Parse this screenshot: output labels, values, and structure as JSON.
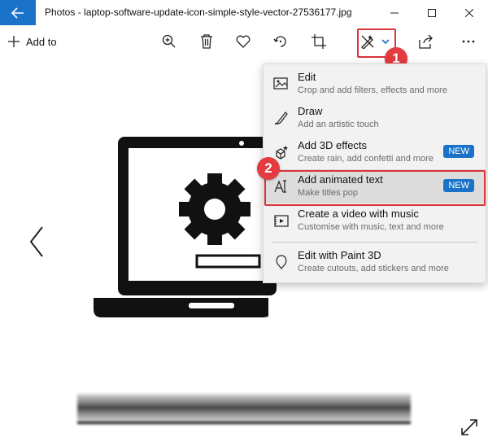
{
  "window": {
    "title": "Photos - laptop-software-update-icon-simple-style-vector-27536177.jpg"
  },
  "toolbar": {
    "add_to_label": "Add to",
    "icons": [
      "zoom-in-icon",
      "delete-icon",
      "heart-icon",
      "rotate-icon",
      "crop-icon",
      "edit-create-icon",
      "chevron-down-icon",
      "share-icon",
      "more-icon"
    ]
  },
  "callouts": {
    "step1": "1",
    "step2": "2"
  },
  "menu": {
    "items": [
      {
        "label": "Edit",
        "desc": "Crop and add filters, effects and more",
        "icon": "edit-image-icon"
      },
      {
        "label": "Draw",
        "desc": "Add an artistic touch",
        "icon": "draw-pen-icon"
      },
      {
        "label": "Add 3D effects",
        "desc": "Create rain, add confetti and more",
        "badge": "NEW",
        "icon": "3d-effects-icon"
      },
      {
        "label": "Add animated text",
        "desc": "Make titles pop",
        "badge": "NEW",
        "icon": "animated-text-icon"
      },
      {
        "label": "Create a video with music",
        "desc": "Customise with music, text and more",
        "icon": "video-icon"
      },
      {
        "label": "Edit with Paint 3D",
        "desc": "Create cutouts, add stickers and more",
        "icon": "paint3d-icon"
      }
    ]
  },
  "colors": {
    "accent": "#1a73c8",
    "callout_red": "#d9343a"
  }
}
